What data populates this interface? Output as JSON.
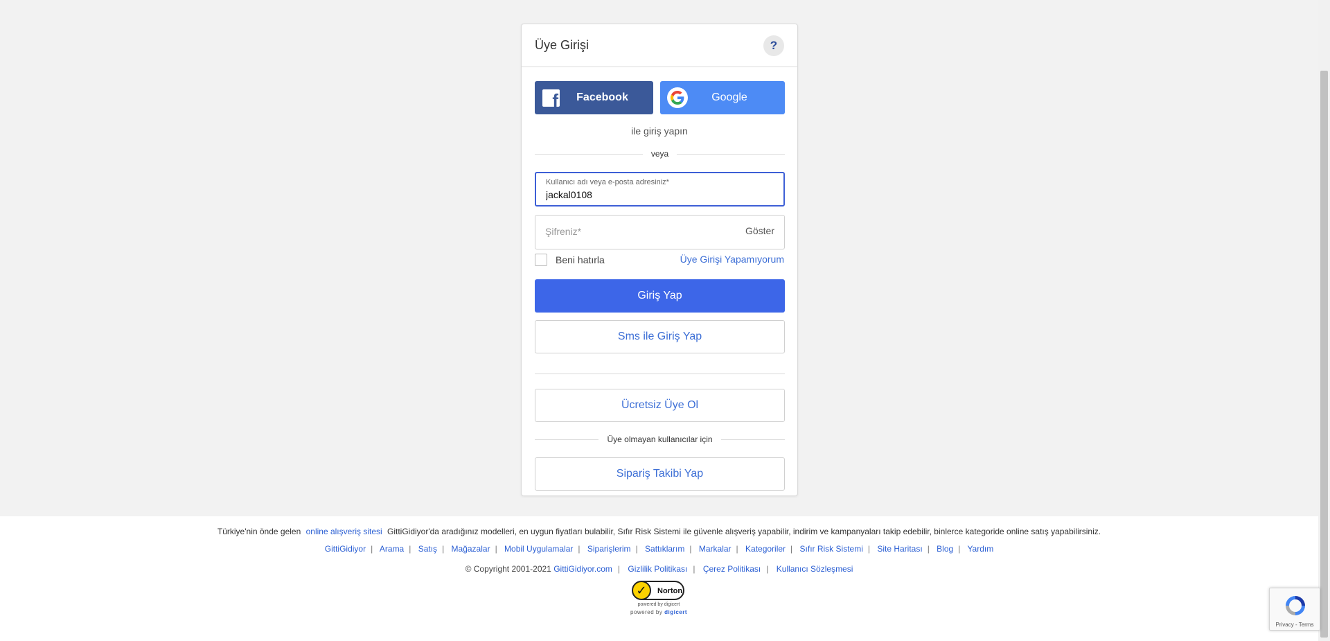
{
  "login": {
    "title": "Üye Girişi",
    "help_label": "?",
    "facebook_label": "Facebook",
    "google_label": "Google",
    "social_hint": "ile giriş yapın",
    "or_label": "veya",
    "username_label": "Kullanıcı adı veya e-posta adresiniz*",
    "username_value": "jackal0108",
    "password_placeholder": "Şifreniz*",
    "show_password_label": "Göster",
    "remember_label": "Beni hatırla",
    "forgot_label": "Üye Girişi Yapamıyorum",
    "login_button": "Giriş Yap",
    "sms_login_button": "Sms ile Giriş Yap",
    "register_button": "Ücretsiz Üye Ol",
    "guest_separator": "Üye olmayan kullanıcılar için",
    "order_tracking_button": "Sipariş Takibi Yap"
  },
  "footer": {
    "intro_prefix": "Türkiye'nin önde gelen",
    "intro_link": "online alışveriş sitesi",
    "intro_text": "GittiGidiyor'da aradığınız modelleri, en uygun fiyatları bulabilir, Sıfır Risk Sistemi ile güvenle alışveriş yapabilir, indirim ve kampanyaları takip edebilir, binlerce kategoride online satış yapabilirsiniz.",
    "links": [
      "GittiGidiyor",
      "Arama",
      "Satış",
      "Mağazalar",
      "Mobil Uygulamalar",
      "Siparişlerim",
      "Sattıklarım",
      "Markalar",
      "Kategoriler",
      "Sıfır Risk Sistemi",
      "Site Haritası",
      "Blog",
      "Yardım"
    ],
    "copyright": "© Copyright 2001-2021",
    "site_link": "GittiGidiyor.com",
    "privacy_link": "Gizlilik Politikası",
    "cookie_link": "Çerez Politikası",
    "agreement_link": "Kullanıcı Sözleşmesi",
    "norton_name": "Norton",
    "norton_powered": "powered by digicert",
    "norton_powered2_prefix": "powered by",
    "norton_powered2_brand": "digicert"
  },
  "recaptcha": {
    "terms": "Privacy - Terms"
  },
  "colors": {
    "primary": "#3d66e8",
    "facebook": "#3b5999",
    "google": "#4d8bf5",
    "link": "#2b5fd3"
  },
  "icons": {
    "help": "question-mark-icon",
    "facebook": "facebook-icon",
    "google": "google-icon",
    "norton": "norton-check-icon",
    "recaptcha": "recaptcha-icon"
  }
}
